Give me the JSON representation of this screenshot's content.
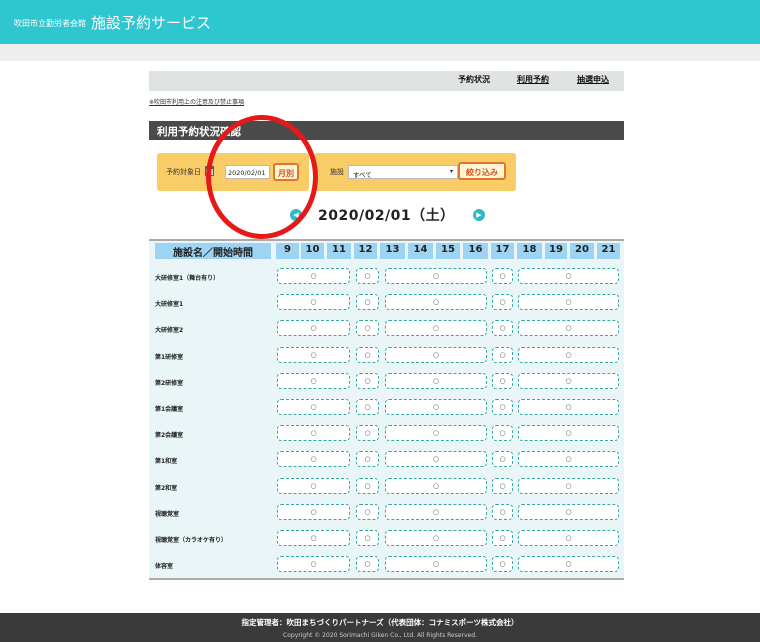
{
  "header": {
    "subtitle": "吹田市立勤労者会館",
    "title": "施設予約サービス"
  },
  "tabs": [
    {
      "label": "予約状況",
      "current": true
    },
    {
      "label": "利用予約",
      "current": false
    },
    {
      "label": "抽選申込",
      "current": false
    }
  ],
  "notice": "※吹田市利用上の注意及び禁止事項",
  "section_title": "利用予約状況確認",
  "filter": {
    "date_label": "予約対象日",
    "date_value": "2020/02/01",
    "monthly_button": "月別",
    "facility_label": "施設",
    "facility_value": "すべて",
    "filter_button": "絞り込み"
  },
  "date_nav": {
    "date": "2020/02/01（土）",
    "prev": "◀",
    "next": "▶"
  },
  "grid": {
    "header_label": "施設名／開始時間",
    "hours": [
      "9",
      "10",
      "11",
      "12",
      "13",
      "14",
      "15",
      "16",
      "17",
      "18",
      "19",
      "20",
      "21"
    ],
    "cell_symbol": "○",
    "rows": [
      "大研修室1（舞台有り）",
      "大研修室1",
      "大研修室2",
      "第1研修室",
      "第2研修室",
      "第1会議室",
      "第2会議室",
      "第1和室",
      "第2和室",
      "視聴覚室",
      "視聴覚室（カラオケ有り）",
      "体容室"
    ]
  },
  "footer": {
    "line1": "指定管理者：吹田まちづくりパートナーズ（代表団体：コナミスポーツ株式会社）",
    "line2": "Copyright © 2020 Sorimachi Giken Co., Ltd. All Rights Reserved."
  },
  "colors": {
    "header": "#2ec6cf",
    "accent_orange": "#e07626",
    "filter_bg": "#f8cd67",
    "annotation": "#e61919"
  }
}
